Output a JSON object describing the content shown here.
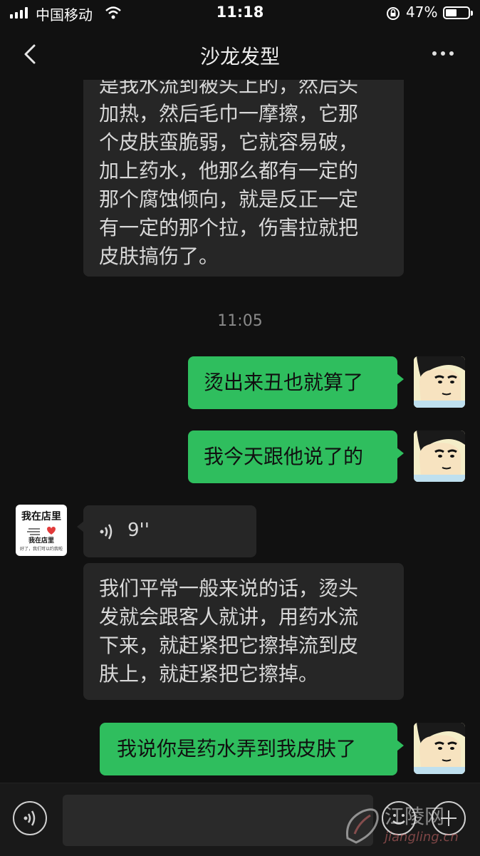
{
  "status_bar": {
    "carrier": "中国移动",
    "time": "11:18",
    "battery": "47%",
    "battery_level": 0.47
  },
  "nav": {
    "title": "沙龙发型",
    "back_icon": "chevron-left-icon",
    "more_icon": "more-dots-icon"
  },
  "messages": {
    "m1": {
      "text": "是我水流到被头上的，然后头\n加热，然后毛巾一摩擦，它那\n个皮肤蛮脆弱，它就容易破，\n加上药水，他那么都有一定的\n那个腐蚀倾向，就是反正一定\n有一定的那个拉，伤害拉就把\n皮肤搞伤了。"
    },
    "timestamp": "11:05",
    "m2": {
      "text": "烫出来丑也就算了"
    },
    "m3": {
      "text": "我今天跟他说了的"
    },
    "m4": {
      "duration": "9''"
    },
    "m5": {
      "text": "我们平常一般来说的话，烫头\n发就会跟客人就讲，用药水流\n下来，就赶紧把它擦掉流到皮\n肤上，就赶紧把它擦掉。"
    },
    "m6": {
      "text": "我说你是药水弄到我皮肤了"
    }
  },
  "avatar_store": {
    "line1": "我在店里",
    "line2": "我在店里",
    "line3": "好了，我们可以约我啦"
  },
  "watermark": {
    "name": "江陵网",
    "url": "jiangling.cn"
  },
  "colors": {
    "background": "#111111",
    "incoming_bubble": "#262626",
    "outgoing_bubble": "#2fbe5e"
  }
}
